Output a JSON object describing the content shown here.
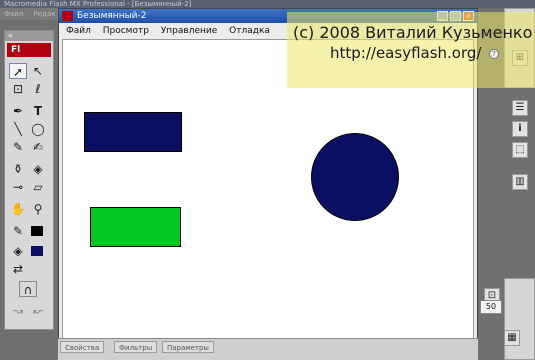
{
  "app": {
    "title": "Macromedia Flash MX Professional - [Безымянный-2]",
    "menu": [
      "Файл",
      "Редак"
    ]
  },
  "document": {
    "title": "Безымянный-2",
    "menu": [
      "Файл",
      "Просмотр",
      "Управление",
      "Отладка"
    ],
    "window_buttons": [
      "_",
      "□",
      "x"
    ]
  },
  "tools_panel": {
    "grip": "«",
    "logo": "Fl",
    "icons": [
      "arrow-icon",
      "subselect-icon",
      "free-transform-icon",
      "lasso-icon",
      "pen-icon",
      "text-icon",
      "line-icon",
      "oval-icon",
      "pencil-icon",
      "brush-icon",
      "ink-bottle-icon",
      "paint-bucket-icon",
      "eyedropper-icon",
      "eraser-icon",
      "hand-icon",
      "zoom-icon",
      "stroke-color-icon",
      "fill-color-icon",
      "magnet-icon",
      "smooth-icon"
    ]
  },
  "stage_shapes": [
    {
      "name": "blue-rectangle",
      "color": "#0b0f64"
    },
    {
      "name": "green-rectangle",
      "color": "#00c81e"
    },
    {
      "name": "blue-circle",
      "color": "#0b0f64"
    }
  ],
  "bottom_tabs": [
    "Свойства",
    "Фильтры",
    "Параметры"
  ],
  "right_panel": {
    "zoom": "50",
    "icons": [
      "align-icon",
      "info-icon",
      "transform-icon",
      "library-icon",
      "color-mixer-icon"
    ]
  },
  "watermark": {
    "line1": "(c) 2008 Виталий Кузьменко",
    "line2": "http://easyflash.org/"
  },
  "colors": {
    "stroke": "#0b0f64",
    "fill": "#000000",
    "accent": "#b00010"
  }
}
